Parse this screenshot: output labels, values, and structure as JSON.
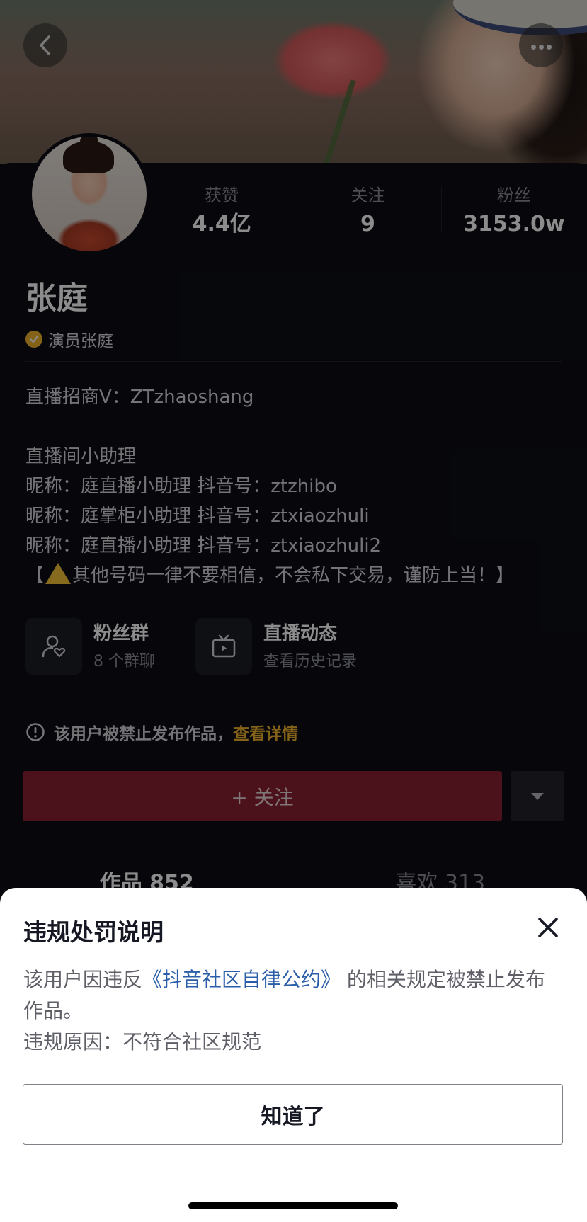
{
  "profile": {
    "name": "张庭",
    "verify_label": "演员张庭",
    "stats": [
      {
        "label": "获赞",
        "value": "4.4亿"
      },
      {
        "label": "关注",
        "value": "9"
      },
      {
        "label": "粉丝",
        "value": "3153.0w"
      }
    ]
  },
  "bio": {
    "line1": "直播招商V：ZTzhaoshang",
    "line2": "直播间小助理",
    "line3": "昵称：庭直播小助理   抖音号：ztzhibo",
    "line4": "昵称：庭掌柜小助理   抖音号：ztxiaozhuli",
    "line5": "昵称：庭直播小助理   抖音号：ztxiaozhuli2",
    "line6_prefix": "【",
    "line6_text": "其他号码一律不要相信，不会私下交易，谨防上当！】"
  },
  "chips": [
    {
      "title": "粉丝群",
      "sub": "8 个群聊",
      "icon": "user-heart-icon"
    },
    {
      "title": "直播动态",
      "sub": "查看历史记录",
      "icon": "tv-icon"
    }
  ],
  "notice": {
    "text": "该用户被禁止发布作品，",
    "link": "查看详情"
  },
  "actions": {
    "follow_label": "+ 关注"
  },
  "tabs": [
    {
      "label": "作品 852"
    },
    {
      "label": "喜欢 313"
    }
  ],
  "sheet": {
    "title": "违规处罚说明",
    "text_before": "该用户因违反",
    "text_link": "《抖音社区自律公约》",
    "text_after": " 的相关规定被禁止发布作品。",
    "reason": "违规原因：不符合社区规范",
    "ok_label": "知道了"
  },
  "colors": {
    "follow_button": "#8a2234",
    "link_yellow": "#f0b52d",
    "link_blue": "#2a5ea8"
  }
}
